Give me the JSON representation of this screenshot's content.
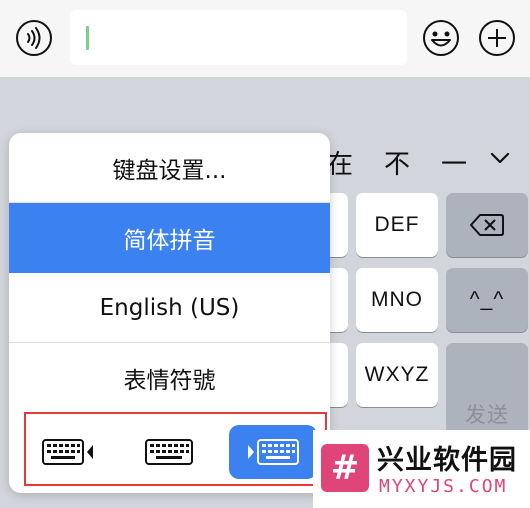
{
  "top_bar": {
    "voice_icon": "voice-wave-icon",
    "emoji_icon": "smiley-icon",
    "plus_icon": "plus-circle-icon",
    "input_value": ""
  },
  "candidates": [
    "在",
    "不",
    "一"
  ],
  "expand_icon": "chevron-down-icon",
  "keys": {
    "def": "DEF",
    "mno": "MNO",
    "wxyz": "WXYZ",
    "emoticon": "^_^",
    "send": "发送",
    "delete_icon": "backspace-icon"
  },
  "popup": {
    "items": [
      "键盘设置...",
      "简体拼音",
      "English (US)",
      "表情符號"
    ],
    "selected_index": 1,
    "keyboard_modes": [
      {
        "name": "left-handed-keyboard-icon",
        "active": false
      },
      {
        "name": "full-keyboard-icon",
        "active": false
      },
      {
        "name": "right-handed-keyboard-icon",
        "active": true
      }
    ]
  },
  "watermark": {
    "title": "兴业软件园",
    "url": "MYXYJS.COM",
    "logo_glyph": "#"
  },
  "colors": {
    "accent": "#3b82f0",
    "highlight_frame": "#e23a3a",
    "watermark": "#e0457a"
  }
}
